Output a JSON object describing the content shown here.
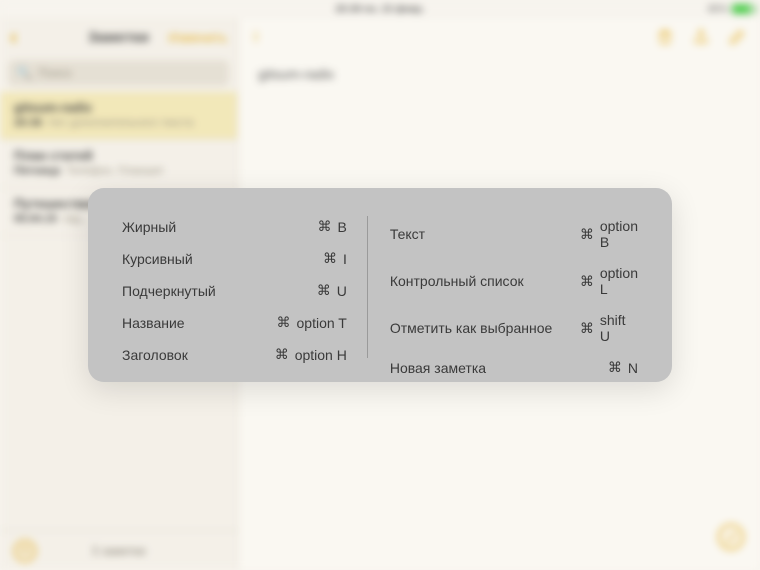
{
  "status": {
    "center": "20:39 пн. 15 февр.",
    "right_pct": "85%"
  },
  "sidebar": {
    "back_glyph": "‹",
    "title": "Заметки",
    "action": "Изменить",
    "search_placeholder": "Поиск",
    "notes": [
      {
        "title": "gitsum-radix",
        "time": "20:36",
        "sub": "Нет дополнительного текста",
        "selected": true
      },
      {
        "title": "План статей",
        "time": "Пятница",
        "sub": "Телефон. Планшет",
        "selected": false
      },
      {
        "title": "Путешествия",
        "time": "05.04.15",
        "sub": "свд...",
        "selected": false
      }
    ],
    "footer_count": "3 заметки",
    "footer_plus": "+"
  },
  "editor": {
    "body_text": "gitsum-radix"
  },
  "shortcuts": {
    "left": [
      {
        "label": "Жирный",
        "keys": [
          "⌘",
          "B"
        ]
      },
      {
        "label": "Курсивный",
        "keys": [
          "⌘",
          "I"
        ]
      },
      {
        "label": "Подчеркнутый",
        "keys": [
          "⌘",
          "U"
        ]
      },
      {
        "label": "Название",
        "keys": [
          "⌘",
          "option T"
        ]
      },
      {
        "label": "Заголовок",
        "keys": [
          "⌘",
          "option H"
        ]
      }
    ],
    "right": [
      {
        "label": "Текст",
        "keys": [
          "⌘",
          "option B"
        ]
      },
      {
        "label": "Контрольный список",
        "keys": [
          "⌘",
          "option L"
        ]
      },
      {
        "label": "Отметить как выбранное",
        "keys": [
          "⌘",
          "shift U"
        ]
      },
      {
        "label": "Новая заметка",
        "keys": [
          "⌘",
          "N"
        ]
      }
    ]
  }
}
